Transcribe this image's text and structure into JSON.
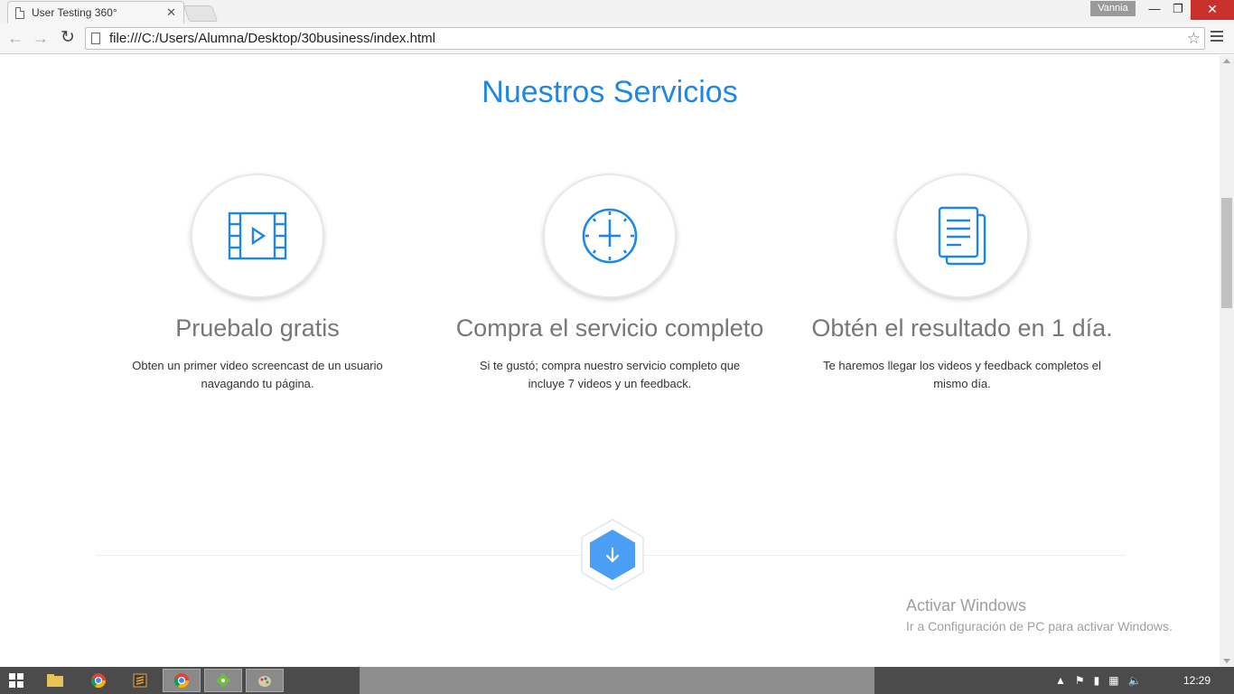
{
  "browser": {
    "tab_title": "User Testing 360°",
    "tab_close": "✕",
    "user_name": "Vannia",
    "url": "file:///C:/Users/Alumna/Desktop/30business/index.html",
    "window_min": "—",
    "window_max": "❐",
    "window_close": "✕"
  },
  "page": {
    "section_title": "Nuestros Servicios",
    "services": [
      {
        "icon": "video-icon",
        "title": "Pruebalo gratis",
        "description": "Obten un primer video screencast de un usuario navagando tu página."
      },
      {
        "icon": "clock-icon",
        "title": "Compra el servicio completo",
        "description": "Si te gustó; compra nuestro servicio completo que incluye 7 videos y un feedback."
      },
      {
        "icon": "documents-icon",
        "title": "Obtén el resultado en 1 día.",
        "description": "Te haremos llegar los videos y feedback completos el mismo día."
      }
    ],
    "accent_color": "#1e87e5",
    "hex_button_color": "#4a9ff5"
  },
  "watermark": {
    "line1": "Activar Windows",
    "line2": "Ir a Configuración de PC para activar Windows."
  },
  "taskbar": {
    "clock": "12:29"
  }
}
